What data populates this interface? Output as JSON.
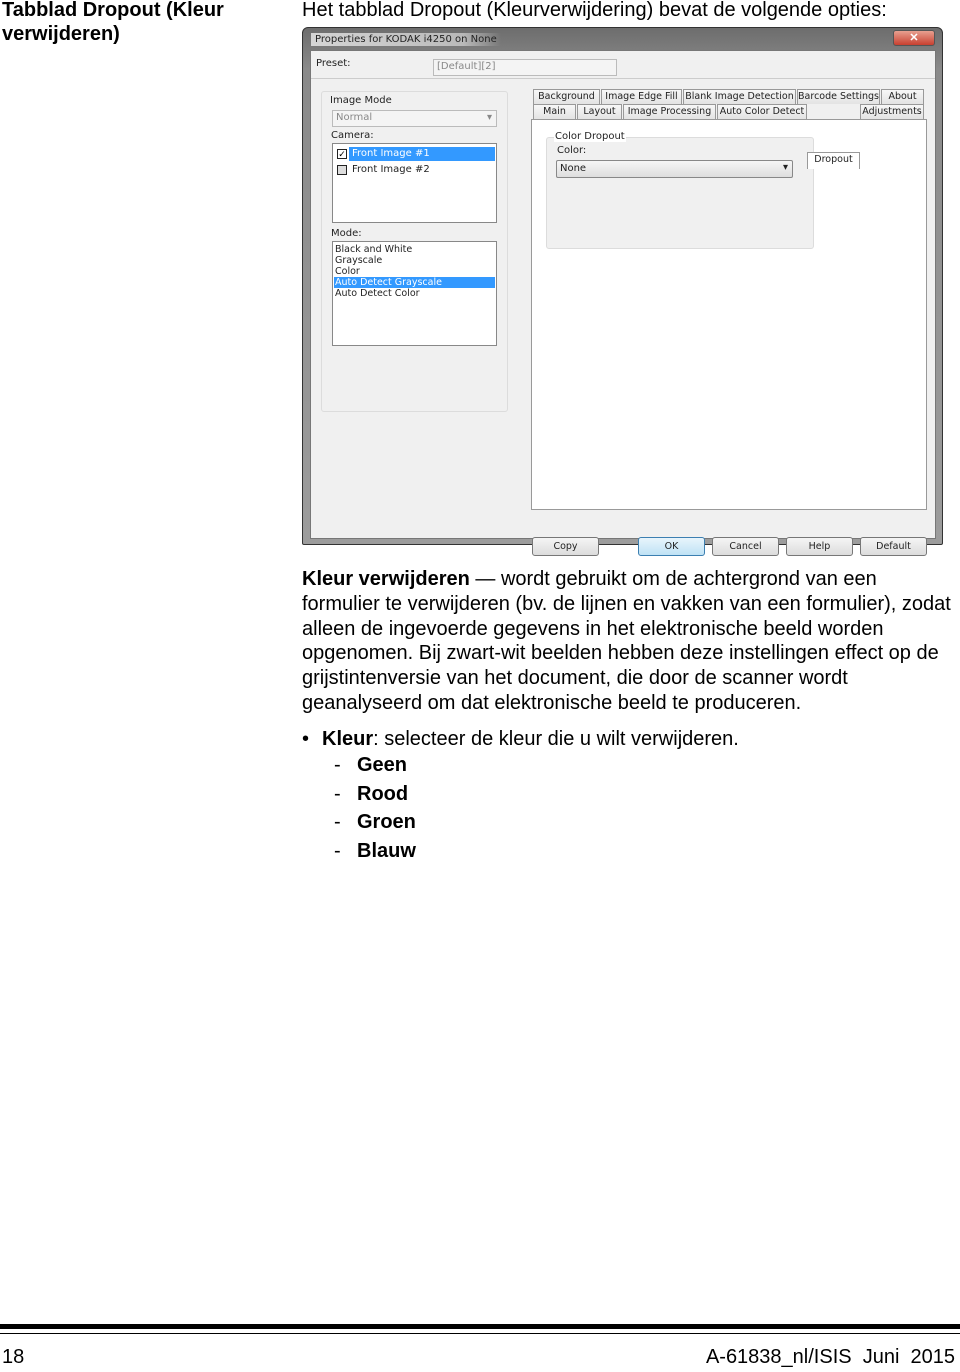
{
  "heading": "Tabblad Dropout (Kleur verwijderen)",
  "intro": "Het tabblad Dropout (Kleurverwijdering) bevat de volgende opties:",
  "dialog": {
    "title": "Properties for KODAK i4250 on None",
    "close_icon": "close-icon",
    "preset_label": "Preset:",
    "preset_value": "[Default][2]",
    "image_mode_label": "Image Mode",
    "image_mode_value": "Normal",
    "camera_label": "Camera:",
    "camera_items": [
      {
        "label": "Front Image #1",
        "checked": true,
        "selected": true
      },
      {
        "label": "Front Image #2",
        "checked": false,
        "selected": false
      }
    ],
    "mode_label": "Mode:",
    "mode_items": [
      "Black and White",
      "Grayscale",
      "Color",
      "Auto Detect Grayscale",
      "Auto Detect Color"
    ],
    "mode_selected": "Auto Detect Grayscale",
    "tabs_row1": [
      "Background",
      "Image Edge Fill",
      "Blank Image Detection",
      "Barcode Settings",
      "About"
    ],
    "tabs_row2": [
      "Main",
      "Layout",
      "Image Processing",
      "Auto Color Detect",
      "Dropout",
      "Adjustments"
    ],
    "active_tab": "Dropout",
    "group_label": "Color Dropout",
    "color_label": "Color:",
    "color_value": "None",
    "buttons": [
      "Copy",
      "OK",
      "Cancel",
      "Help",
      "Default"
    ]
  },
  "body": {
    "term": "Kleur verwijderen",
    "description": " — wordt gebruikt om de achtergrond van een formulier te verwijderen (bv. de lijnen en vakken van een formulier), zodat alleen de ingevoerde gegevens in het elektronische beeld worden opgenomen. Bij zwart-wit beelden hebben deze instellingen effect op de grijstintenversie van het document, die door de scanner wordt geanalyseerd om dat elektronische beeld te produceren.",
    "bullet_term": "Kleur",
    "bullet_text": ": selecteer de kleur die u wilt verwijderen.",
    "options": [
      "Geen",
      "Rood",
      "Groen",
      "Blauw"
    ]
  },
  "footer": {
    "page": "18",
    "doc": "A-61838_nl/ISIS  Juni  2015"
  }
}
